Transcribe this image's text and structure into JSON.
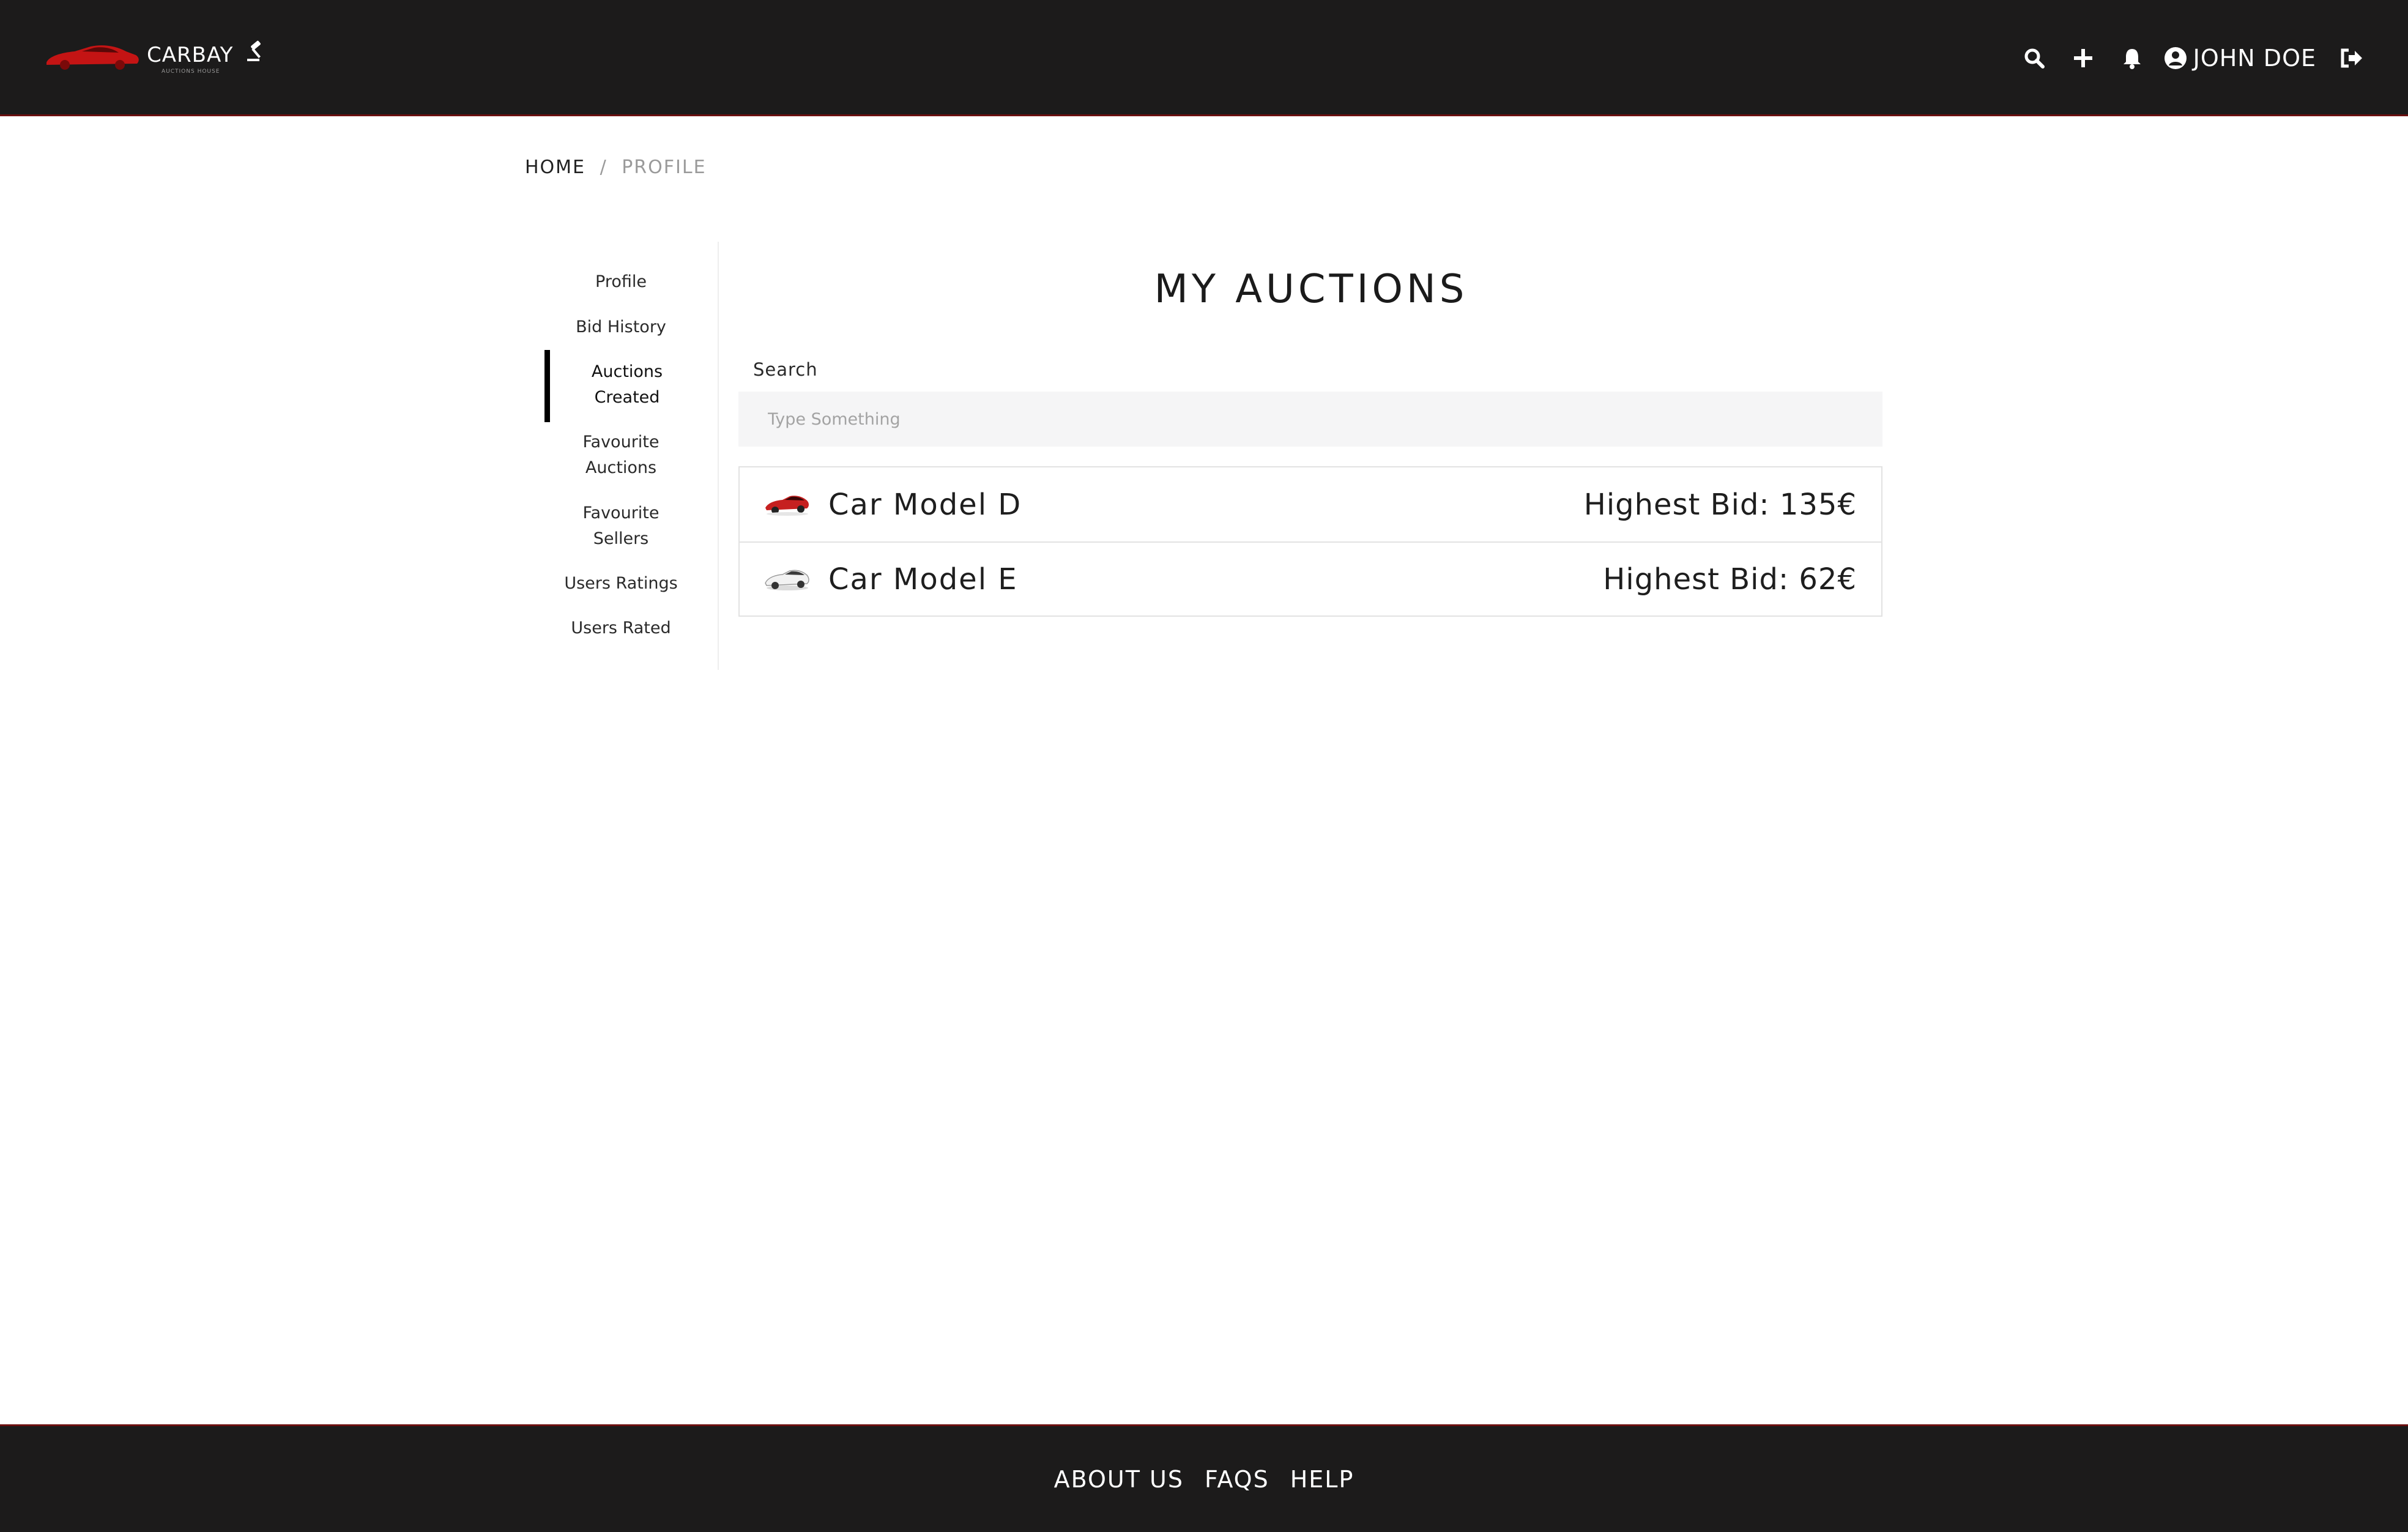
{
  "header": {
    "brand": "CARBAY",
    "tagline": "AUCTIONS HOUSE",
    "icons": [
      "search-icon",
      "plus-icon",
      "bell-icon",
      "user-circle-icon",
      "sign-out-icon"
    ],
    "user_name": "JOHN DOE"
  },
  "breadcrumb": {
    "home": "HOME",
    "separator": "/",
    "current": "PROFILE"
  },
  "sidebar": {
    "items": [
      {
        "label": "Profile"
      },
      {
        "label": "Bid History"
      },
      {
        "label_line1": "Auctions",
        "label_line2": "Created",
        "active": true
      },
      {
        "label_line1": "Favourite",
        "label_line2": "Auctions"
      },
      {
        "label_line1": "Favourite",
        "label_line2": "Sellers"
      },
      {
        "label": "Users Ratings"
      },
      {
        "label": "Users Rated"
      }
    ]
  },
  "main": {
    "title": "MY AUCTIONS",
    "search_label": "Search",
    "search_placeholder": "Type Something",
    "search_value": "",
    "auctions": [
      {
        "name": "Car Model D",
        "bid": "Highest Bid: 135€",
        "thumb_color": "#c62020"
      },
      {
        "name": "Car Model E",
        "bid": "Highest Bid: 62€",
        "thumb_color": "#d8d8d8"
      }
    ]
  },
  "footer": {
    "links": [
      "ABOUT US",
      "FAQS",
      "HELP"
    ]
  },
  "colors": {
    "header_bg": "#1c1b1b",
    "accent": "#c62020",
    "active_bar": "#000000"
  }
}
